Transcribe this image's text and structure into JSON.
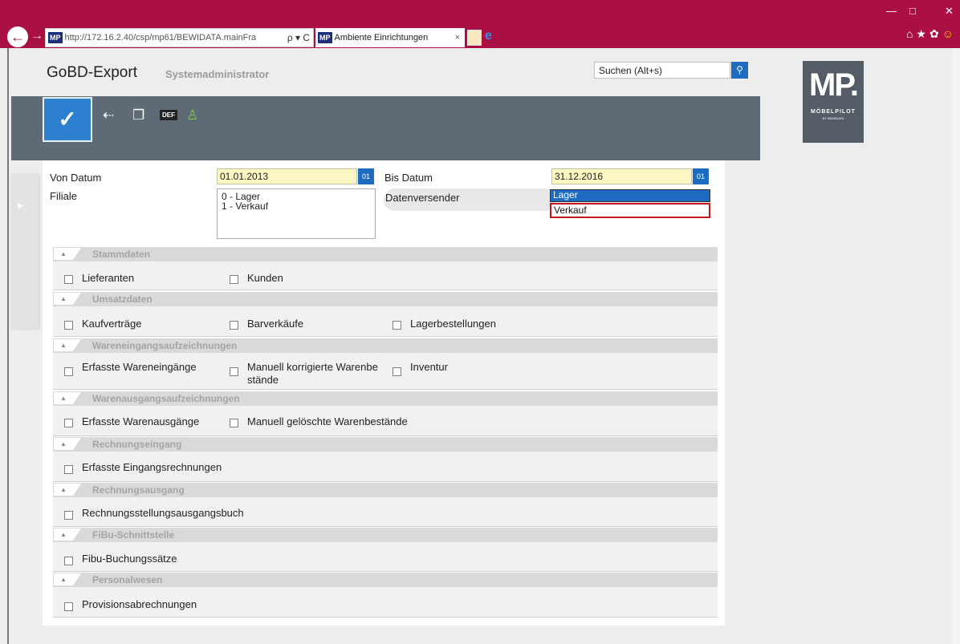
{
  "browser": {
    "address_favicon": "MP",
    "address_url": "http://172.16.2.40/csp/mp61/BEWIDATA.mainFra",
    "address_icons": "ρ ▾ C",
    "tab_favicon": "MP",
    "tab_title": "Ambiente Einrichtungen",
    "tab_close": "×",
    "win_min": "—",
    "win_max": "□",
    "win_close": "✕",
    "home": "⌂",
    "star": "★",
    "gear": "✿",
    "smiley": "☺"
  },
  "app": {
    "title": "GoBD-Export",
    "subtitle": "Systemadministrator",
    "search_placeholder": "Suchen (Alt+s)",
    "logo_text": "MP.",
    "logo_sub": "MÖBELPILOT",
    "logo_sub2": "BY BEWIDATA",
    "toolbar_def": "DEF"
  },
  "form": {
    "von_label": "Von Datum",
    "von_value": "01.01.2013",
    "bis_label": "Bis Datum",
    "bis_value": "31.12.2016",
    "calendar_label": "01",
    "filiale_label": "Filiale",
    "filiale_options": [
      "0 - Lager",
      "1 - Verkauf"
    ],
    "versender_label": "Datenversender",
    "versender_options": [
      "Lager",
      "Verkauf"
    ]
  },
  "sections": [
    {
      "title": "Stammdaten",
      "items": [
        "Lieferanten",
        "Kunden"
      ]
    },
    {
      "title": "Umsatzdaten",
      "items": [
        "Kaufverträge",
        "Barverkäufe",
        "Lagerbestellungen"
      ]
    },
    {
      "title": "Wareneingangsaufzeichnungen",
      "items": [
        "Erfasste Wareneingänge",
        "Manuell korrigierte Warenbe ",
        "stände",
        "Inventur"
      ]
    },
    {
      "title": "Warenausgangsaufzeichnungen",
      "items": [
        "Erfasste Warenausgänge",
        "Manuell gelöschte Warenbestände"
      ]
    },
    {
      "title": "Rechnungseingang",
      "items": [
        "Erfasste Eingangsrechnungen"
      ]
    },
    {
      "title": "Rechnungsausgang",
      "items": [
        "Rechnungsstellungsausgangsbuch"
      ]
    },
    {
      "title": "FiBu-Schnittstelle",
      "items": [
        "Fibu-Buchungssätze"
      ]
    },
    {
      "title": "Personalwesen",
      "items": [
        "Provisionsabrechnungen"
      ]
    }
  ]
}
